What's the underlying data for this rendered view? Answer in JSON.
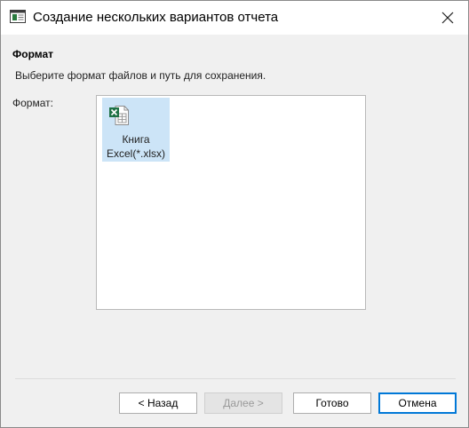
{
  "window": {
    "title": "Создание нескольких вариантов отчета",
    "app_icon": "report-window-icon",
    "close_icon": "close-icon"
  },
  "section": {
    "title": "Формат",
    "description": "Выберите формат файлов и путь для сохранения."
  },
  "format": {
    "label": "Формат:",
    "items": [
      {
        "icon": "excel-file-icon",
        "line1": "Книга",
        "line2": "Excel(*.xlsx)",
        "selected": true
      }
    ]
  },
  "buttons": {
    "back": "< Назад",
    "next": "Далее >",
    "done": "Готово",
    "cancel": "Отмена"
  },
  "colors": {
    "selection": "#cce4f7",
    "focus_border": "#0078d7",
    "excel_green": "#1e7145"
  }
}
